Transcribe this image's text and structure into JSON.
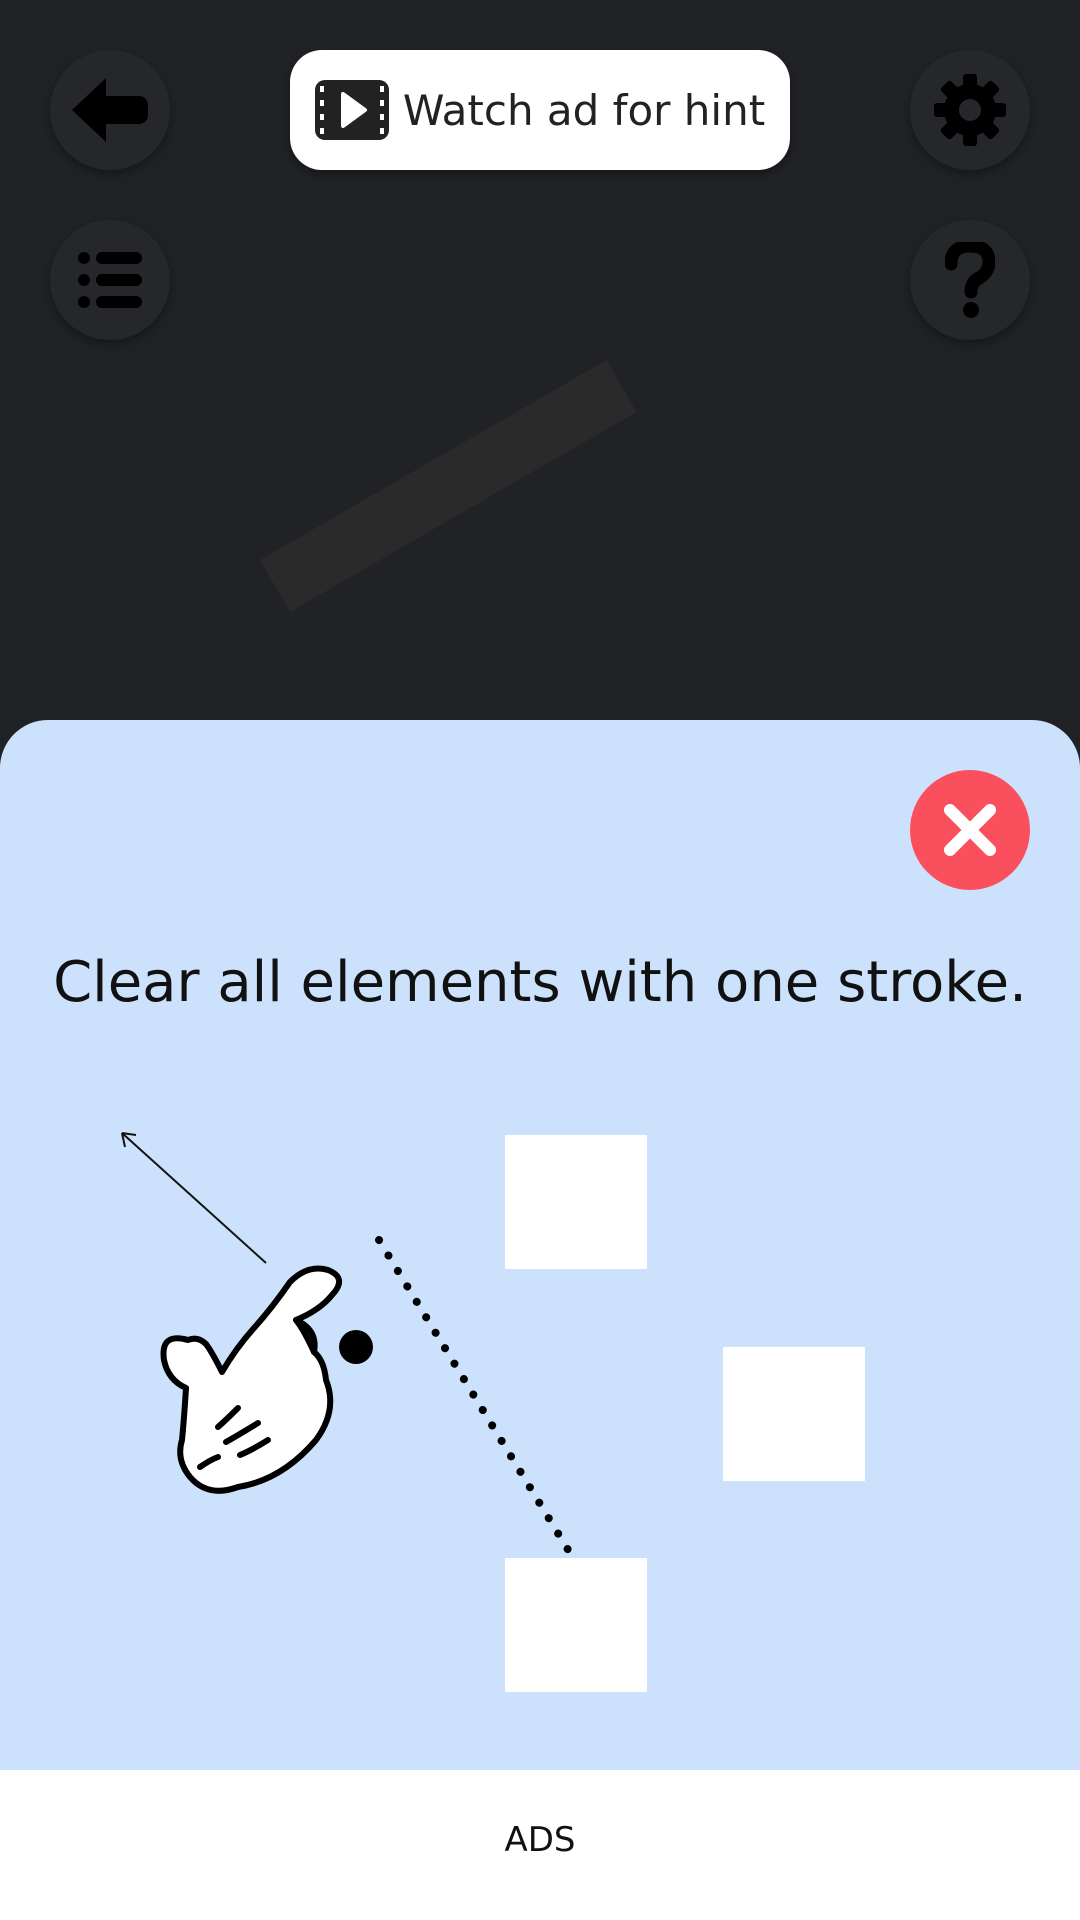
{
  "toolbar": {
    "back_icon": "back-arrow-icon",
    "settings_icon": "gear-icon",
    "levels_icon": "list-icon",
    "help_icon": "question-icon"
  },
  "hint": {
    "label": "Watch ad for hint",
    "icon": "video-play-icon"
  },
  "tutorial": {
    "instruction": "Clear all elements with one stroke.",
    "close_icon": "close-icon",
    "background_color": "#cce2fc",
    "close_color": "#fa4f5c"
  },
  "ads": {
    "label": "ADS"
  }
}
